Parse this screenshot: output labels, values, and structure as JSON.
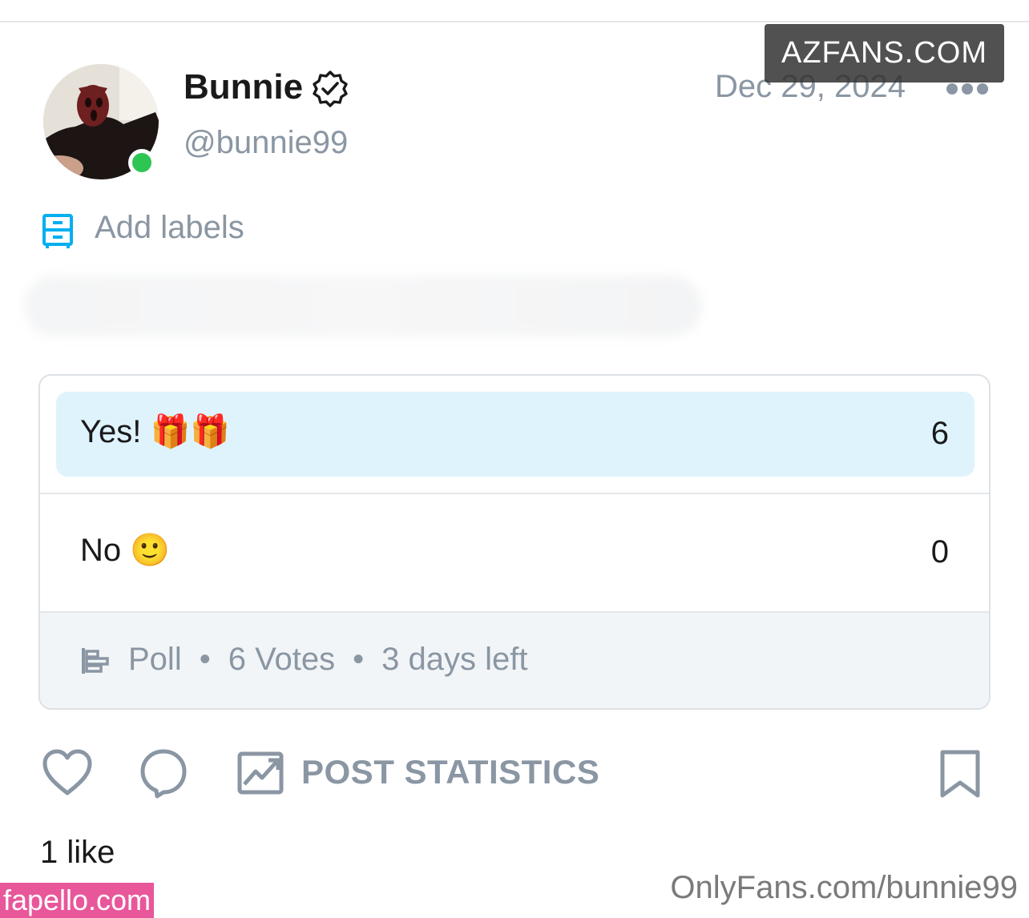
{
  "author": {
    "name": "Bunnie",
    "handle": "@bunnie99",
    "verified": true,
    "online": true
  },
  "post": {
    "date": "Dec 29, 2024",
    "labels_action": "Add labels"
  },
  "poll": {
    "options": [
      {
        "label": "Yes! 🎁🎁",
        "count": "6",
        "selected": true
      },
      {
        "label": "No 🙂",
        "count": "0",
        "selected": false
      }
    ],
    "meta": {
      "type": "Poll",
      "votes": "6 Votes",
      "time_left": "3 days left"
    }
  },
  "actions": {
    "stats_label": "POST STATISTICS"
  },
  "likes_text": "1 like",
  "watermarks": {
    "top_right": "AZFANS.COM",
    "bottom_left": "fapello.com",
    "bottom_right": "OnlyFans.com/bunnie99"
  },
  "colors": {
    "accent": "#00aff0",
    "selected_fill": "#dff3fc",
    "muted_text": "#8a96a3",
    "online": "#2dc653"
  },
  "icons": [
    "verified-badge-icon",
    "more-icon",
    "labels-icon",
    "poll-icon",
    "heart-icon",
    "comment-icon",
    "stats-icon",
    "bookmark-icon"
  ]
}
